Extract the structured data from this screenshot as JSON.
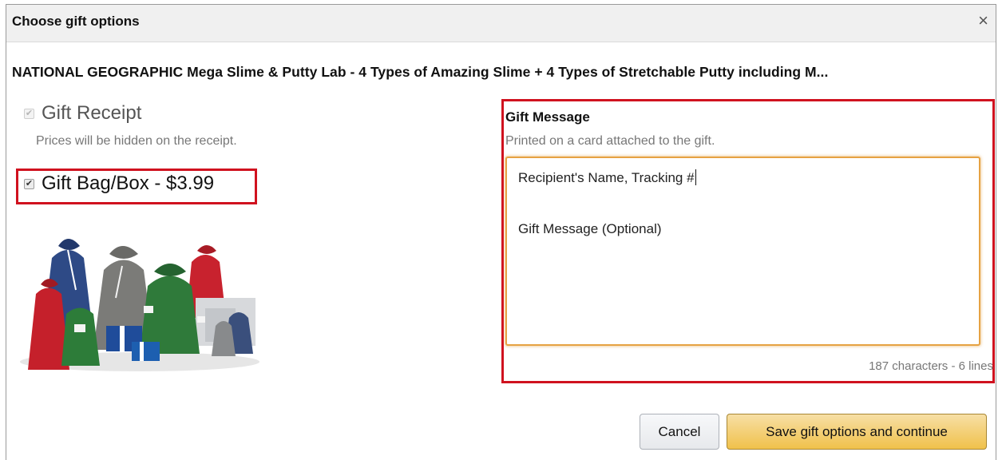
{
  "dialog": {
    "title": "Choose gift options",
    "close_label": "×"
  },
  "product": {
    "title": "NATIONAL GEOGRAPHIC Mega Slime & Putty Lab - 4 Types of Amazing Slime + 4 Types of Stretchable Putty including M..."
  },
  "options": {
    "gift_receipt": {
      "label": "Gift Receipt",
      "note": "Prices will be hidden on the receipt.",
      "checked": true,
      "disabled": true
    },
    "gift_bag": {
      "label": "Gift Bag/Box - $3.99",
      "checked": true
    }
  },
  "gift_message": {
    "heading": "Gift Message",
    "subheading": "Printed on a card attached to the gift.",
    "line1": "Recipient's Name, Tracking #",
    "line2": "Gift Message (Optional)",
    "char_count": "187 characters - 6 lines"
  },
  "buttons": {
    "cancel": "Cancel",
    "save": "Save gift options and continue"
  },
  "colors": {
    "highlight_red": "#d0121f",
    "textarea_focus": "#e6a243",
    "primary_button": "#f0c14b"
  }
}
